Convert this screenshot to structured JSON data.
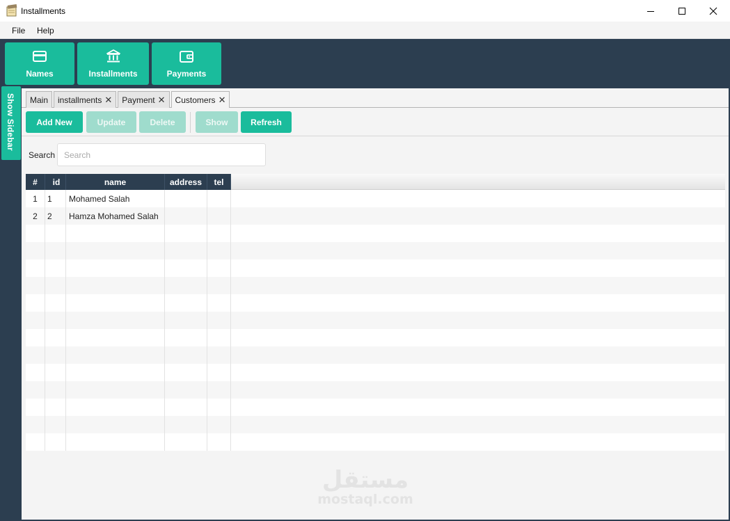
{
  "window": {
    "title": "Installments",
    "icon": "notepad-icon"
  },
  "menu": {
    "items": [
      "File",
      "Help"
    ]
  },
  "nav": {
    "items": [
      {
        "label": "Names",
        "icon": "credit-card-icon"
      },
      {
        "label": "Installments",
        "icon": "bank-icon"
      },
      {
        "label": "Payments",
        "icon": "wallet-icon"
      }
    ]
  },
  "sidebar": {
    "toggle_label": "Show Sidebar"
  },
  "tabs": [
    {
      "label": "Main",
      "closable": false
    },
    {
      "label": "installments",
      "closable": true
    },
    {
      "label": "Payment",
      "closable": true
    },
    {
      "label": "Customers",
      "closable": true,
      "active": true
    }
  ],
  "tab_close_glyph": "✕",
  "toolbar": {
    "add_new": "Add New",
    "update": "Update",
    "delete": "Delete",
    "show": "Show",
    "refresh": "Refresh"
  },
  "search": {
    "label": "Search",
    "placeholder": "Search",
    "value": ""
  },
  "table": {
    "columns": [
      "#",
      "id",
      "name",
      "address",
      "tel"
    ],
    "rows": [
      [
        "1",
        "1",
        "Mohamed Salah",
        "",
        ""
      ],
      [
        "2",
        "2",
        "Hamza Mohamed Salah",
        "",
        ""
      ]
    ],
    "empty_rows": 13
  },
  "watermark": {
    "arabic": "مستقل",
    "latin": "mostaql.com"
  },
  "colors": {
    "primary": "#1abc9c",
    "primary_disabled": "#9fdccd",
    "dark": "#2c3e50",
    "content_bg": "#f4f4f4"
  }
}
